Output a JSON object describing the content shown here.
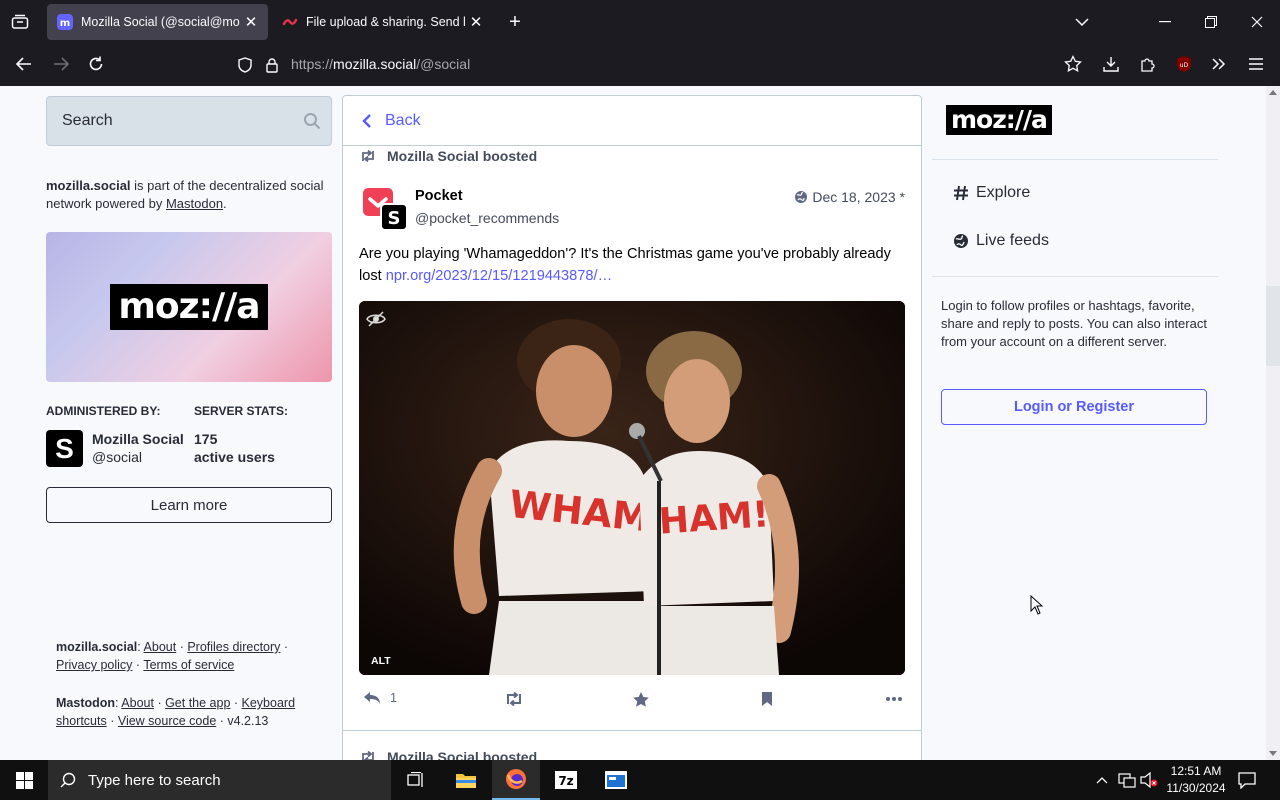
{
  "browser": {
    "tabs": [
      {
        "title": "Mozilla Social (@social@mozill",
        "active": true
      },
      {
        "title": "File upload & sharing. Send larg",
        "active": false
      }
    ],
    "url_scheme": "https://",
    "url_host": "mozilla.social",
    "url_path": "/@social"
  },
  "sidebar": {
    "search_placeholder": "Search",
    "about_server": "mozilla.social",
    "about_text": " is part of the decentralized social network powered by ",
    "about_link": "Mastodon",
    "about_end": ".",
    "hero_logo": "moz://a",
    "administered_by_heading": "ADMINISTERED BY:",
    "server_stats_heading": "SERVER STATS:",
    "admin_avatar_letter": "S",
    "admin_name": "Mozilla Social",
    "admin_handle": "@social",
    "stats_count": "175",
    "stats_label": "active users",
    "learn_more": "Learn more",
    "footer1": {
      "server": "mozilla.social",
      "links": [
        "About",
        "Profiles directory",
        "Privacy policy",
        "Terms of service"
      ]
    },
    "footer2": {
      "label": "Mastodon",
      "links": [
        "About",
        "Get the app",
        "Keyboard shortcuts",
        "View source code"
      ],
      "version": "v4.2.13"
    }
  },
  "column": {
    "back_label": "Back",
    "boost_label": "Mozilla Social boosted",
    "post": {
      "author": "Pocket",
      "handle": "@pocket_recommends",
      "date": "Dec 18, 2023",
      "edited_mark": "*",
      "text": "Are you playing 'Whamageddon'? It's the Christmas game you've probably already lost ",
      "link": "npr.org/2023/12/15/1219443878/…",
      "media_alt_badge": "ALT",
      "reply_count": "1"
    },
    "next_boost_label": "Mozilla Social boosted"
  },
  "right": {
    "logo": "moz://a",
    "nav": [
      {
        "label": "Explore",
        "icon": "hashtag-icon"
      },
      {
        "label": "Live feeds",
        "icon": "globe-icon"
      }
    ],
    "login_text": "Login to follow profiles or hashtags, favorite, share and reply to posts. You can also interact from your account on a different server.",
    "login_button": "Login or Register"
  },
  "taskbar": {
    "search_placeholder": "Type here to search",
    "time": "12:51 AM",
    "date": "11/30/2024"
  },
  "colors": {
    "accent": "#595aff",
    "browser_chrome": "#1c1b22",
    "taskbar": "#101010"
  }
}
